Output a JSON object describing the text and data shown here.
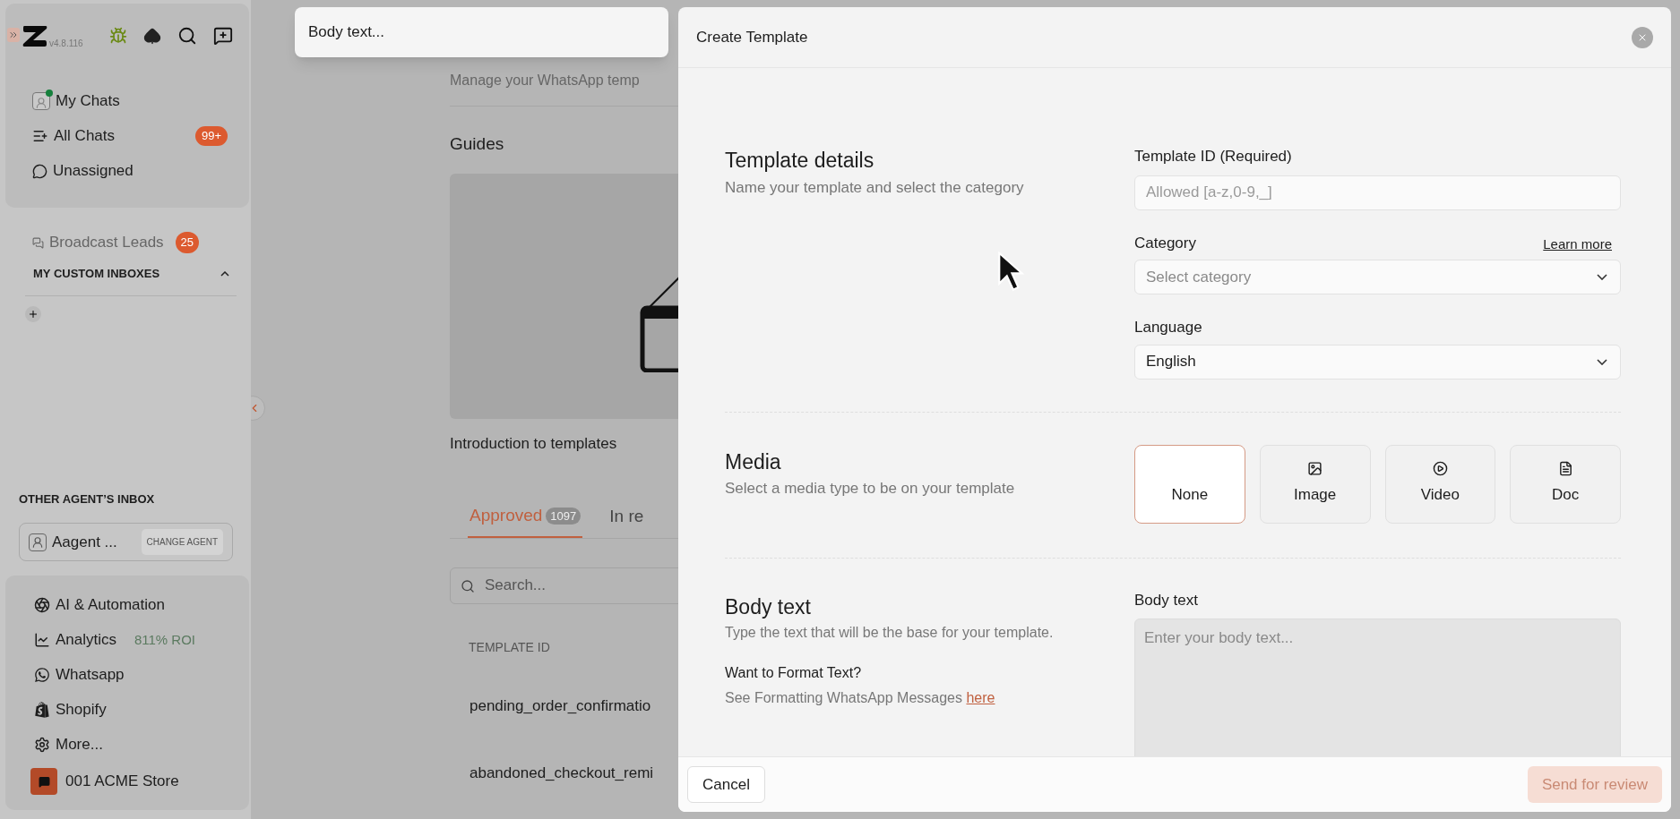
{
  "sidebar": {
    "version": "v4.8.116",
    "nav": [
      {
        "label": "My Chats",
        "kind": "my",
        "online": true
      },
      {
        "label": "All Chats",
        "kind": "all",
        "badge": "99+"
      },
      {
        "label": "Unassigned",
        "kind": "unassigned"
      }
    ],
    "broadcast": {
      "label": "Broadcast Leads",
      "badge": "25"
    },
    "custom_inboxes": {
      "title": "MY CUSTOM INBOXES",
      "expanded": true
    },
    "other_agents": {
      "title": "OTHER AGENT’S INBOX",
      "agent": "Aagent ...",
      "button": "CHANGE AGENT"
    },
    "tools": [
      {
        "label": "AI & Automation",
        "kind": "ai"
      },
      {
        "label": "Analytics",
        "kind": "analytics",
        "note": "811% ROI"
      },
      {
        "label": "Whatsapp",
        "kind": "whatsapp"
      },
      {
        "label": "Shopify",
        "kind": "shopify"
      },
      {
        "label": "More...",
        "kind": "more"
      }
    ],
    "store": "001 ACME Store"
  },
  "popup": {
    "text": "Body text..."
  },
  "page": {
    "subtitle": "Manage your WhatsApp temp",
    "guides_title": "Guides",
    "guide_caption": "Introduction to templates",
    "tabs": [
      {
        "label": "Approved",
        "count": "1097",
        "selected": true
      },
      {
        "label": "In re",
        "selected": false
      }
    ],
    "search": {
      "placeholder": "Search..."
    },
    "table": {
      "columns": [
        "TEMPLATE ID"
      ],
      "rows": [
        "pending_order_confirmatio",
        "abandoned_checkout_remi"
      ]
    }
  },
  "modal": {
    "title": "Create Template",
    "details": {
      "title": "Template details",
      "subtitle": "Name your template and select the category",
      "id_label": "Template ID (Required)",
      "id_placeholder": "Allowed [a-z,0-9,_]",
      "category_label": "Category",
      "learn_more": "Learn more",
      "category_placeholder": "Select category",
      "language_label": "Language",
      "language_value": "English"
    },
    "media": {
      "title": "Media",
      "subtitle": "Select a media type to be on your template",
      "options": [
        {
          "label": "None",
          "kind": "none",
          "selected": true
        },
        {
          "label": "Image",
          "kind": "image",
          "selected": false
        },
        {
          "label": "Video",
          "kind": "video",
          "selected": false
        },
        {
          "label": "Doc",
          "kind": "doc",
          "selected": false
        }
      ]
    },
    "body": {
      "title": "Body text",
      "subtitle": "Type the text that will be the base for your template.",
      "format_title": "Want to Format Text?",
      "format_text": "See Formatting WhatsApp Messages",
      "format_link": "here",
      "label": "Body text",
      "placeholder": "Enter your body text..."
    },
    "footer": {
      "cancel": "Cancel",
      "submit": "Send for review",
      "submit_disabled": true
    }
  }
}
